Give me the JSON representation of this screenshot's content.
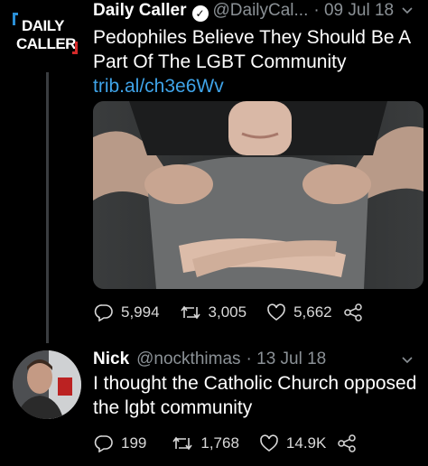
{
  "tweet1": {
    "avatar": {
      "line1": "DAILY",
      "line2": "CALLER"
    },
    "name": "Daily Caller",
    "handle": "@DailyCal...",
    "date": "· 09 Jul 18",
    "text": "Pedophiles Believe They Should Be A Part Of The LGBT Community",
    "link": "trib.al/ch3e6Wv",
    "stats": {
      "replies": "5,994",
      "retweets": "3,005",
      "likes": "5,662"
    }
  },
  "tweet2": {
    "name": "Nick",
    "handle": "@nockthimas",
    "date": "· 13 Jul 18",
    "text": "I thought the Catholic Church opposed the lgbt community",
    "stats": {
      "replies": "199",
      "retweets": "1,768",
      "likes": "14.9K"
    }
  },
  "colors": {
    "background": "#000000",
    "link": "#3fa3e8",
    "muted": "#8b9196"
  },
  "icons": [
    "verified-icon",
    "chevron-down-icon",
    "reply-icon",
    "retweet-icon",
    "like-icon",
    "share-icon"
  ]
}
